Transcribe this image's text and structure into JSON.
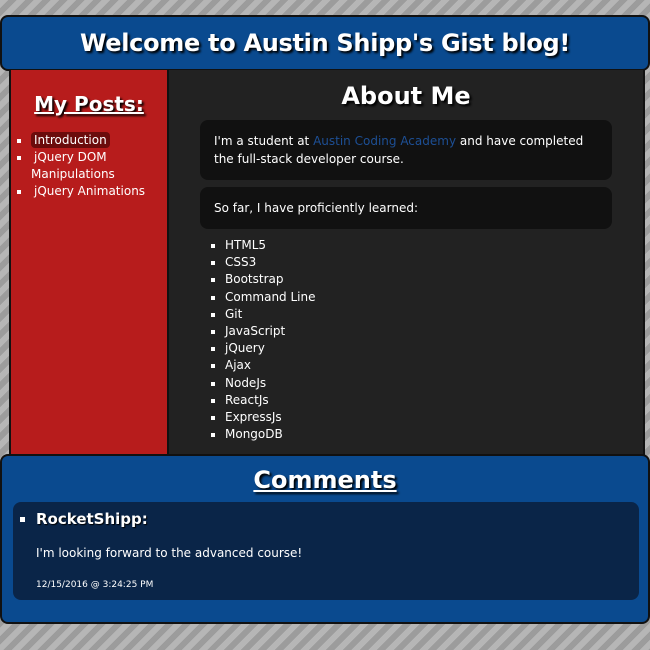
{
  "header": {
    "title": "Welcome to Austin Shipp's Gist blog!"
  },
  "sidebar": {
    "heading": "My Posts:",
    "items": [
      {
        "label": "Introduction"
      },
      {
        "label": "jQuery DOM Manipulations"
      },
      {
        "label": "jQuery Animations"
      }
    ]
  },
  "main": {
    "heading": "About Me",
    "intro_before": "I'm a student at ",
    "intro_link": "Austin Coding Academy",
    "intro_after": " and have completed the full-stack developer course.",
    "learned_text": "So far, I have proficiently learned:",
    "skills": [
      "HTML5",
      "CSS3",
      "Bootstrap",
      "Command Line",
      "Git",
      "JavaScript",
      "jQuery",
      "Ajax",
      "NodeJs",
      "ReactJs",
      "ExpressJs",
      "MongoDB"
    ]
  },
  "comments": {
    "heading": "Comments",
    "items": [
      {
        "author": "RocketShipp:",
        "body": "I'm looking forward to the advanced course!",
        "timestamp": "12/15/2016 @ 3:24:25 PM"
      }
    ]
  },
  "colors": {
    "header_blue": "#0a4a8f",
    "sidebar_red": "#b71c1c",
    "main_dark": "#222222",
    "link_blue": "#1d4f95"
  }
}
